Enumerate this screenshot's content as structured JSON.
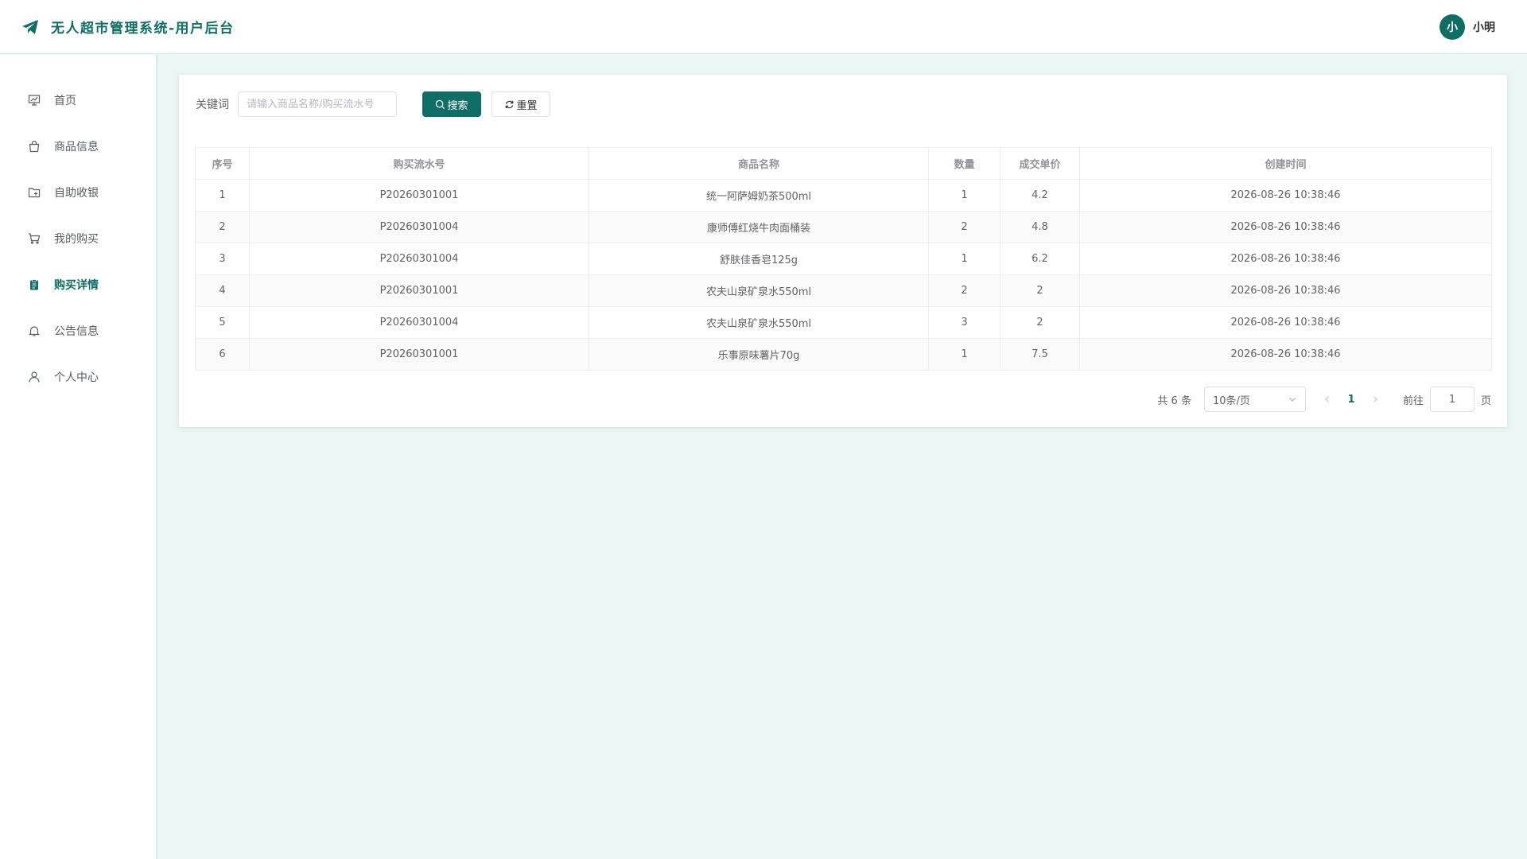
{
  "header": {
    "title": "无人超市管理系统-用户后台",
    "user": {
      "avatar_text": "小",
      "name": "小明"
    }
  },
  "sidebar": {
    "items": [
      {
        "label": "首页",
        "icon": "presentation-chart-icon",
        "active": false
      },
      {
        "label": "商品信息",
        "icon": "shopping-bag-icon",
        "active": false
      },
      {
        "label": "自助收银",
        "icon": "folder-add-icon",
        "active": false
      },
      {
        "label": "我的购买",
        "icon": "shopping-cart-icon",
        "active": false
      },
      {
        "label": "购买详情",
        "icon": "clipboard-icon",
        "active": true
      },
      {
        "label": "公告信息",
        "icon": "bell-icon",
        "active": false
      },
      {
        "label": "个人中心",
        "icon": "user-icon",
        "active": false
      }
    ]
  },
  "search": {
    "label": "关键词",
    "placeholder": "请输入商品名称/购买流水号",
    "value": "",
    "search_button": "搜索",
    "reset_button": "重置"
  },
  "table": {
    "columns": [
      "序号",
      "购买流水号",
      "商品名称",
      "数量",
      "成交单价",
      "创建时间"
    ],
    "rows": [
      [
        "1",
        "P20260301001",
        "统一阿萨姆奶茶500ml",
        "1",
        "4.2",
        "2026-08-26 10:38:46"
      ],
      [
        "2",
        "P20260301004",
        "康师傅红烧牛肉面桶装",
        "2",
        "4.8",
        "2026-08-26 10:38:46"
      ],
      [
        "3",
        "P20260301004",
        "舒肤佳香皂125g",
        "1",
        "6.2",
        "2026-08-26 10:38:46"
      ],
      [
        "4",
        "P20260301001",
        "农夫山泉矿泉水550ml",
        "2",
        "2",
        "2026-08-26 10:38:46"
      ],
      [
        "5",
        "P20260301004",
        "农夫山泉矿泉水550ml",
        "3",
        "2",
        "2026-08-26 10:38:46"
      ],
      [
        "6",
        "P20260301001",
        "乐事原味薯片70g",
        "1",
        "7.5",
        "2026-08-26 10:38:46"
      ]
    ]
  },
  "pagination": {
    "total_text": "共 6 条",
    "page_size": "10条/页",
    "current_page": "1",
    "goto_label": "前往",
    "goto_value": "1",
    "page_suffix": "页"
  },
  "colors": {
    "primary": "#0e6e66",
    "page_bg": "#eaf7f5",
    "border": "#cfeee8"
  }
}
